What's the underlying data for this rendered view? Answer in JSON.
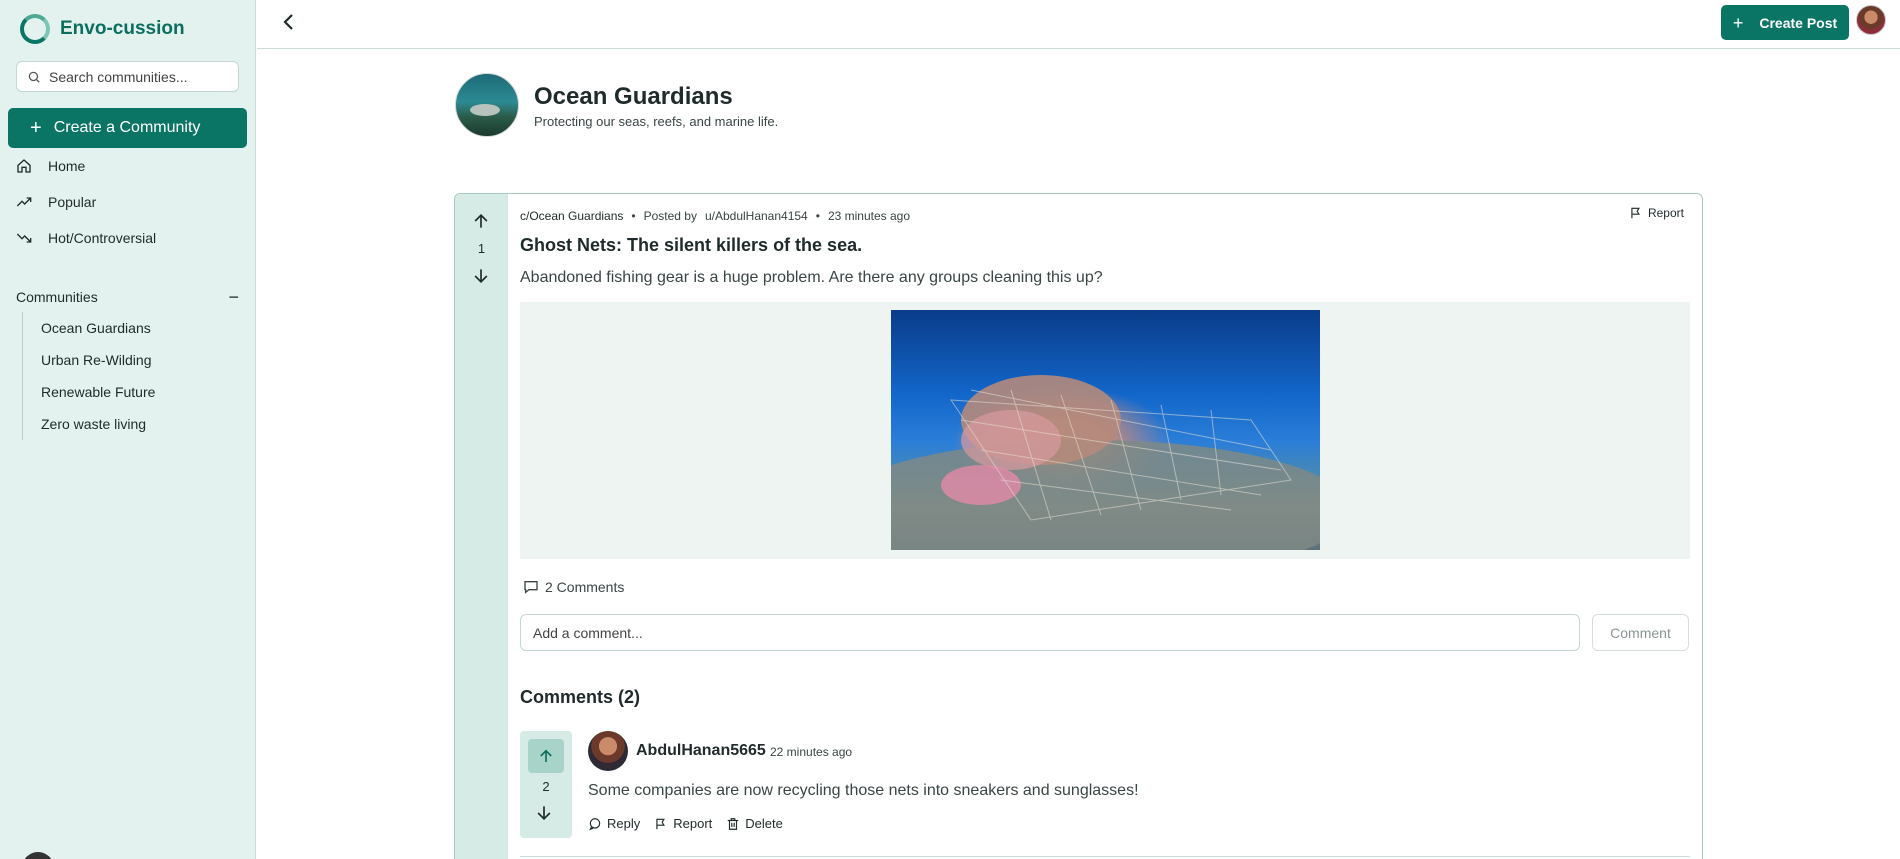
{
  "app": {
    "name": "Envo-cussion"
  },
  "sidebar": {
    "search_placeholder": "Search communities...",
    "create_community_label": "Create a Community",
    "nav": [
      {
        "label": "Home",
        "icon": "home-icon"
      },
      {
        "label": "Popular",
        "icon": "trending-up-icon"
      },
      {
        "label": "Hot/Controversial",
        "icon": "trending-down-icon"
      }
    ],
    "communities_heading": "Communities",
    "communities": [
      "Ocean Guardians",
      "Urban Re-Wilding",
      "Renewable Future",
      "Zero waste living"
    ]
  },
  "topbar": {
    "create_post_label": "Create Post"
  },
  "community": {
    "title": "Ocean Guardians",
    "description": "Protecting our seas, reefs, and marine life."
  },
  "post": {
    "community": "c/Ocean Guardians",
    "posted_by_label": "Posted by",
    "author": "u/AbdulHanan4154",
    "time": "23 minutes ago",
    "votes": "1",
    "report_label": "Report",
    "title": "Ghost Nets: The silent killers of the sea.",
    "body": "Abandoned fishing gear is a huge problem. Are there any groups cleaning this up?",
    "comments_link": "2 Comments",
    "comment_placeholder": "Add a comment...",
    "comment_button": "Comment"
  },
  "comments": {
    "heading": "Comments (2)",
    "items": [
      {
        "author": "AbdulHanan5665",
        "time": "22 minutes ago",
        "votes": "2",
        "text": "Some companies are now recycling those nets into sneakers and sunglasses!",
        "actions": {
          "reply": "Reply",
          "report": "Report",
          "delete": "Delete"
        }
      }
    ]
  },
  "colors": {
    "accent": "#0b7565",
    "sidebar_bg": "#e3f2ee",
    "vote_bg": "#d6ebe5"
  }
}
